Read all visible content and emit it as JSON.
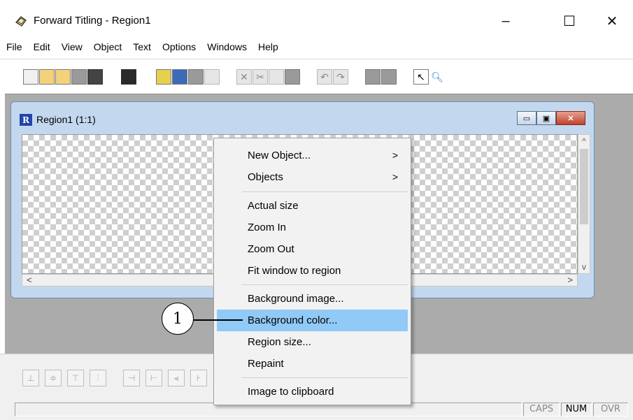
{
  "window": {
    "title": "Forward Titling - Region1",
    "icon": "app-icon",
    "controls": {
      "minimize": "–",
      "maximize": "☐",
      "close": "✕"
    }
  },
  "menubar": {
    "items": [
      "File",
      "Edit",
      "View",
      "Object",
      "Text",
      "Options",
      "Windows",
      "Help"
    ]
  },
  "child_window": {
    "title": "Region1  (1:1)",
    "icon_letter": "R",
    "controls": {
      "minimize": "▭",
      "maximize": "▣",
      "close": "✕"
    },
    "scroll": {
      "up": "^",
      "down": "v",
      "left": "<",
      "right": ">"
    }
  },
  "context_menu": {
    "items": [
      {
        "label": "New Object...",
        "submenu": true
      },
      {
        "label": "Objects",
        "submenu": true
      },
      {
        "label": "Actual size"
      },
      {
        "label": "Zoom In"
      },
      {
        "label": "Zoom Out"
      },
      {
        "label": "Fit window to region"
      },
      {
        "label": "Background image..."
      },
      {
        "label": "Background color...",
        "highlighted": true
      },
      {
        "label": "Region size..."
      },
      {
        "label": "Repaint"
      },
      {
        "label": "Image to clipboard"
      }
    ],
    "submenu_arrow": ">"
  },
  "callout": {
    "number": "1"
  },
  "statusbar": {
    "caps": "CAPS",
    "num": "NUM",
    "ovr": "OVR"
  },
  "colors": {
    "highlight": "#91c9f7",
    "mdi_background": "#ababab",
    "child_frame": "#c3d8ee"
  }
}
